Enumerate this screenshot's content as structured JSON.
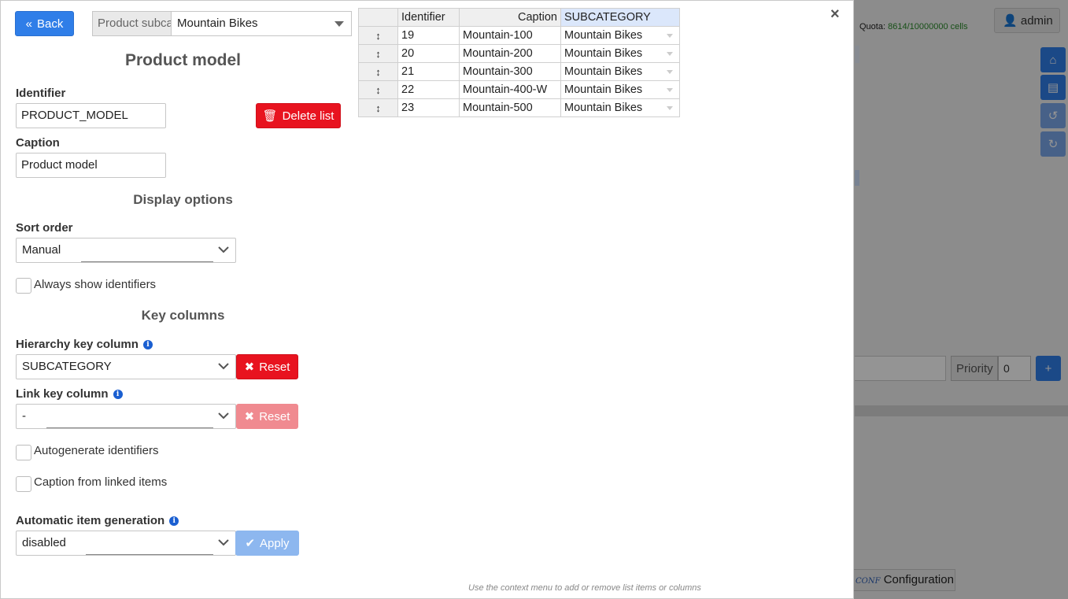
{
  "background": {
    "quota_label": "Quota:",
    "quota_value": "8614/10000000 cells",
    "user_name": "admin",
    "priority_label": "Priority",
    "priority_value": "0",
    "config_badge": "CONF",
    "config_label": "Configuration"
  },
  "header": {
    "back_label": "Back",
    "breadcrumb_label": "Product subcategory",
    "breadcrumb_value": "Mountain Bikes"
  },
  "form": {
    "title": "Product model",
    "identifier_label": "Identifier",
    "identifier_value": "PRODUCT_MODEL",
    "delete_label": "Delete list",
    "caption_label": "Caption",
    "caption_value": "Product model",
    "display_options_title": "Display options",
    "sort_order_label": "Sort order",
    "sort_order_value": "Manual",
    "always_show_ids_label": "Always show identifiers",
    "key_columns_title": "Key columns",
    "hierarchy_key_label": "Hierarchy key column",
    "hierarchy_key_value": "SUBCATEGORY",
    "reset_label": "Reset",
    "link_key_label": "Link key column",
    "link_key_value": "-",
    "autogenerate_label": "Autogenerate identifiers",
    "caption_linked_label": "Caption from linked items",
    "auto_gen_label": "Automatic item generation",
    "auto_gen_value": "disabled",
    "apply_label": "Apply"
  },
  "grid": {
    "columns": [
      "Identifier",
      "Caption",
      "SUBCATEGORY"
    ],
    "rows": [
      {
        "id": "19",
        "caption": "Mountain-100",
        "subcategory": "Mountain Bikes"
      },
      {
        "id": "20",
        "caption": "Mountain-200",
        "subcategory": "Mountain Bikes"
      },
      {
        "id": "21",
        "caption": "Mountain-300",
        "subcategory": "Mountain Bikes"
      },
      {
        "id": "22",
        "caption": "Mountain-400-W",
        "subcategory": "Mountain Bikes"
      },
      {
        "id": "23",
        "caption": "Mountain-500",
        "subcategory": "Mountain Bikes"
      }
    ],
    "hint": "Use the context menu to add or remove list items or columns"
  },
  "colors": {
    "primary": "#2f7ee8",
    "danger": "#e8131f",
    "quota_ok": "#2a8a2a"
  }
}
